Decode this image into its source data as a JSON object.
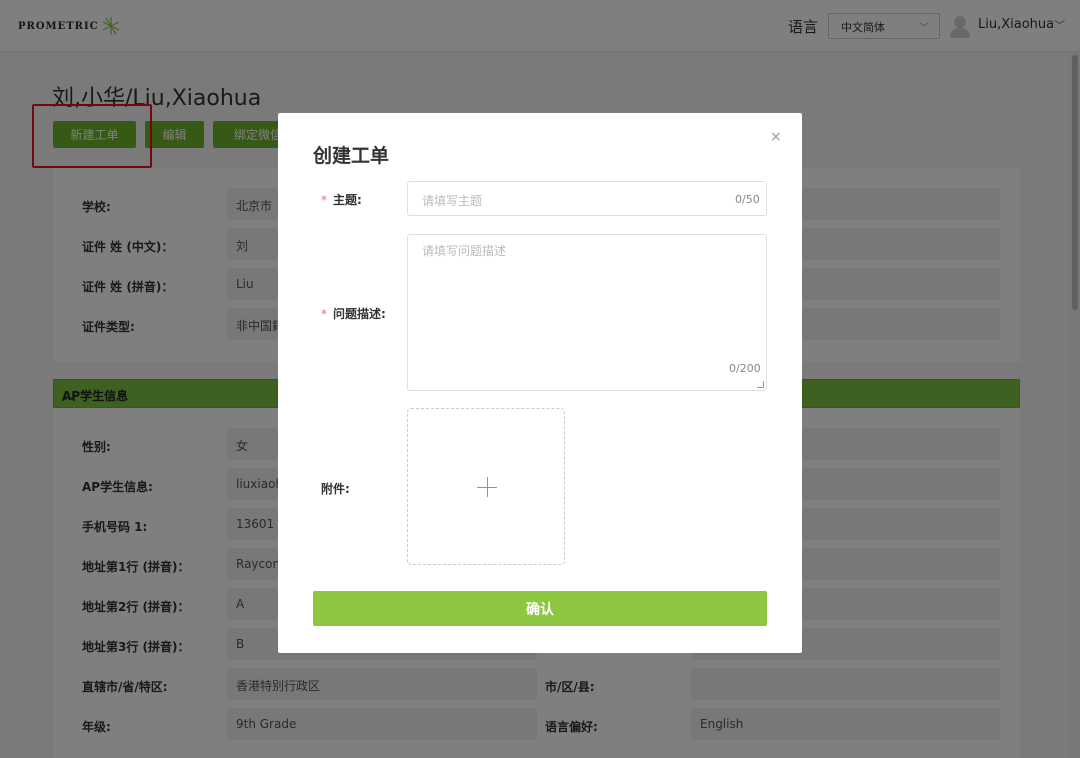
{
  "header": {
    "logo_text": "PROMETRIC",
    "lang_label": "语言",
    "lang_value": "中文简体",
    "user_name": "Liu,Xiaohua",
    "colors": {
      "brand_green": "#6cb52c"
    }
  },
  "page": {
    "title": "刘,小华/Liu,Xiaohua",
    "buttons": {
      "new_ticket": "新建工单",
      "edit": "编辑",
      "bind_wechat": "绑定微信"
    },
    "info_rows": [
      {
        "label": "学校:",
        "value": "北京市"
      },
      {
        "label": "证件 姓 (中文)：",
        "value": "刘"
      },
      {
        "label": "证件 姓 (拼音)：",
        "value": "Liu"
      },
      {
        "label": "证件类型:",
        "value": "非中国籍"
      }
    ],
    "section_title": "AP学生信息",
    "ap_rows": [
      {
        "label": "性别:",
        "value": "女"
      },
      {
        "label": "AP学生信息:",
        "value": "liuxiaoh"
      },
      {
        "label": "手机号码 1:",
        "value": "13601"
      },
      {
        "label": "地址第1行 (拼音)：",
        "value": "Raycon"
      },
      {
        "label": "地址第2行 (拼音)：",
        "value": "A"
      },
      {
        "label": "地址第3行 (拼音)：",
        "value": "B"
      },
      {
        "label": "直辖市/省/特区:",
        "value": "香港特别行政区",
        "label2": "市/区/县:",
        "value2": ""
      },
      {
        "label": "年级:",
        "value": "9th Grade",
        "label2": "语言偏好:",
        "value2": "English"
      }
    ]
  },
  "modal": {
    "title": "创建工单",
    "close": "×",
    "subject_label": "主题:",
    "subject_placeholder": "请填写主题",
    "subject_count": "0/50",
    "desc_label": "问题描述:",
    "desc_placeholder": "请填写问题描述",
    "desc_count": "0/200",
    "attach_label": "附件:",
    "confirm": "确认",
    "required_mark": "*"
  }
}
